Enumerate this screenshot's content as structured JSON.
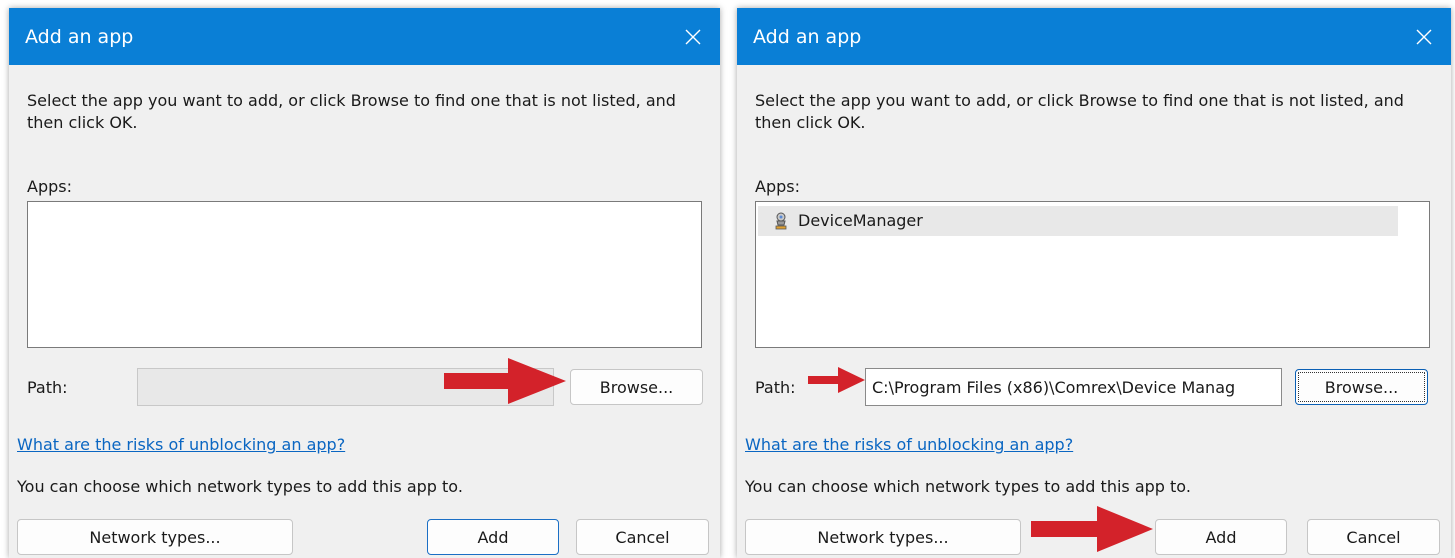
{
  "dialogs": [
    {
      "title": "Add an app",
      "instruction": "Select the app you want to add, or click Browse to find one that is not listed, and then click OK.",
      "apps_label": "Apps:",
      "apps": [],
      "path_label": "Path:",
      "path_value": "",
      "browse_label": "Browse...",
      "risk_link": "What are the risks of unblocking an app?",
      "network_text": "You can choose which network types to add this app to.",
      "network_button": "Network types...",
      "add_button": "Add",
      "cancel_button": "Cancel"
    },
    {
      "title": "Add an app",
      "instruction": "Select the app you want to add, or click Browse to find one that is not listed, and then click OK.",
      "apps_label": "Apps:",
      "apps": [
        {
          "name": "DeviceManager",
          "icon": "device-manager-icon"
        }
      ],
      "path_label": "Path:",
      "path_value": "C:\\Program Files (x86)\\Comrex\\Device Manag",
      "browse_label": "Browse...",
      "risk_link": "What are the risks of unblocking an app?",
      "network_text": "You can choose which network types to add this app to.",
      "network_button": "Network types...",
      "add_button": "Add",
      "cancel_button": "Cancel"
    }
  ],
  "colors": {
    "titlebar": "#0a7fd6",
    "dialog_bg": "#f0f0f0",
    "link": "#0a66c2",
    "annotation_arrow": "#d3222a"
  }
}
